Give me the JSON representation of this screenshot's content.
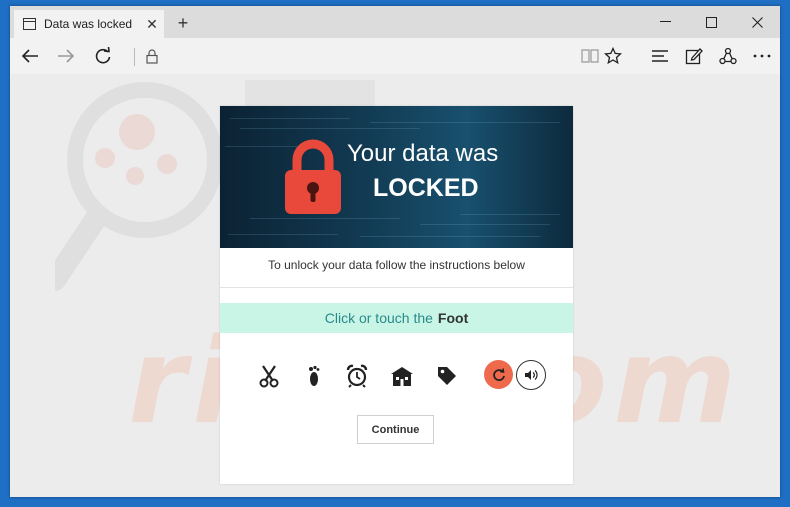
{
  "browser": {
    "tab_title": "Data was locked",
    "tab_close": "✕",
    "new_tab": "+",
    "icons": [
      "page-icon",
      "close-icon",
      "plus-icon",
      "minimize-icon",
      "maximize-icon",
      "window-close-icon",
      "back-arrow-icon",
      "forward-arrow-icon",
      "refresh-icon",
      "lock-icon",
      "reading-view-icon",
      "favorite-star-icon",
      "hub-icon",
      "web-note-icon",
      "share-icon",
      "more-icon"
    ]
  },
  "page": {
    "banner_line1": "Your data was",
    "banner_line2": "LOCKED",
    "instructions": "To unlock your data follow the instructions below",
    "prompt_text": "Click or touch the",
    "prompt_target": "Foot",
    "challenge_icons": [
      "scissors-icon",
      "footprint-icon",
      "alarm-clock-icon",
      "house-icon",
      "price-tag-icon"
    ],
    "continue_label": "Continue",
    "watermark": "risk.com"
  },
  "colors": {
    "padlock": "#e8493a",
    "prompt_bg": "#c8f5e6",
    "prompt_text": "#2a8a8a",
    "refresh_bg": "#ef6a4c",
    "frame": "#1f6fc4"
  }
}
